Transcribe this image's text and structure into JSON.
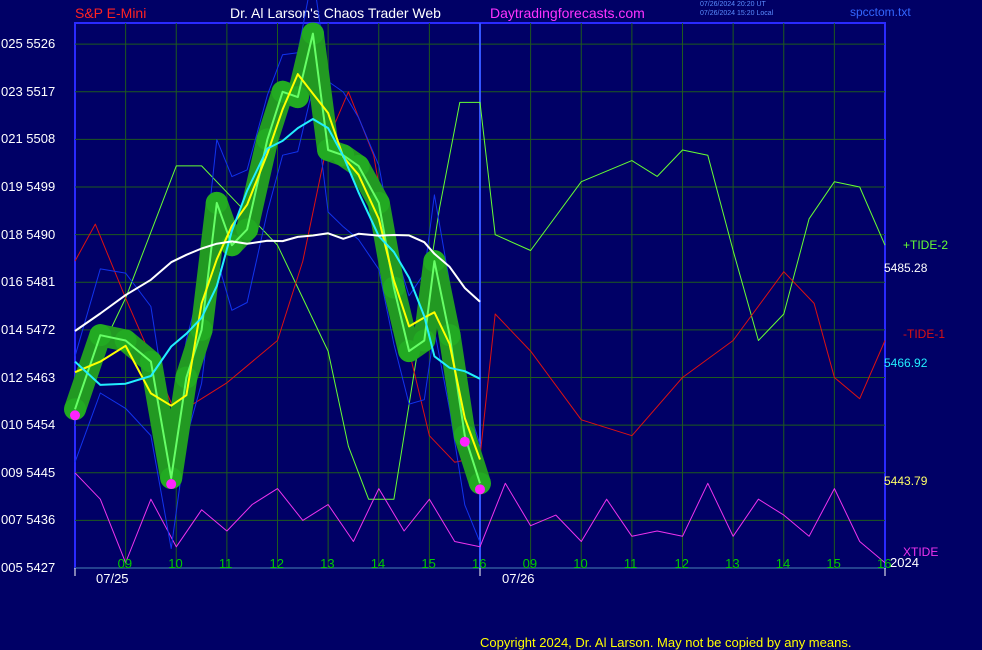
{
  "header": {
    "instrument": "S&P E-Mini",
    "site": "Dr. Al Larson's Chaos Trader Web",
    "url": "Daytradingforecasts.com",
    "time_utc": "07/26/2024 20:20 UT",
    "time_local": "07/26/2024 15:20 Local",
    "filename": "spcctom.txt"
  },
  "y_axis": {
    "left_codes": [
      "025",
      "023",
      "021",
      "019",
      "018",
      "016",
      "014",
      "012",
      "010",
      "009",
      "007",
      "005"
    ],
    "prices": [
      "5526",
      "5517",
      "5508",
      "5499",
      "5490",
      "5481",
      "5472",
      "5463",
      "5454",
      "5445",
      "5436",
      "5427"
    ],
    "range": [
      5427,
      5530
    ]
  },
  "x_axis": {
    "hour_labels_day1": [
      "09",
      "10",
      "11",
      "12",
      "13",
      "14",
      "15",
      "16"
    ],
    "hour_labels_day2": [
      "09",
      "10",
      "11",
      "12",
      "13",
      "14",
      "15",
      "16"
    ],
    "date1": "07/25",
    "date2": "07/26",
    "year": "2024"
  },
  "right_labels": {
    "tide2_label": "+TIDE-2",
    "tide1_label": "-TIDE-1",
    "xtide_label": "XTIDE",
    "value_white": "5485.28",
    "value_cyan": "5466.92",
    "value_yellow": "5443.79"
  },
  "colors": {
    "background": "#000066",
    "plot_border": "#2a2aff",
    "grid": "#1e5a1e",
    "tide2": "#66ff33",
    "tide1": "#dd1111",
    "xtide": "#ee33ee",
    "price_band": "#229922",
    "cyan_avg": "#22eeff",
    "white_avg": "#ffffff",
    "yellow_avg": "#ffff00",
    "blue_band": "#1133ee",
    "magenta_dots": "#ff22ff"
  },
  "chart_data": {
    "type": "line",
    "title": "S&P E-Mini",
    "xlabel": "",
    "ylabel": "",
    "ylim": [
      5427,
      5530
    ],
    "grid": true,
    "session_hours": [
      9,
      10,
      11,
      12,
      13,
      14,
      15,
      16
    ],
    "series": [
      {
        "name": "price",
        "x_hours_day1": [
          8.0,
          8.5,
          9.0,
          9.5,
          9.9,
          10.2,
          10.5,
          10.8,
          11.1,
          11.4,
          11.8,
          12.1,
          12.4,
          12.7,
          13.0,
          13.3,
          13.6,
          14.0,
          14.3,
          14.6,
          14.9,
          15.1,
          15.4,
          15.7,
          16.0
        ],
        "values": [
          5457,
          5471,
          5470,
          5466,
          5444,
          5463,
          5472,
          5496,
          5488,
          5491,
          5508,
          5517,
          5516,
          5528,
          5506,
          5505,
          5503,
          5496,
          5480,
          5468,
          5470,
          5485,
          5471,
          5452,
          5443
        ]
      },
      {
        "name": "+TIDE-2",
        "x_hours": [
          8.0,
          9.0,
          10.0,
          10.5,
          11.0,
          12.0,
          12.5,
          13.0,
          13.4,
          13.8,
          14.3,
          14.8,
          15.2,
          15.6,
          16.0,
          16.3,
          17.0,
          18.0,
          19.0,
          19.5,
          20.0,
          20.5,
          21.0,
          21.5,
          22.0,
          22.5,
          23.0,
          23.5,
          24.0
        ],
        "values": [
          5458,
          5478,
          5503,
          5503,
          5498,
          5488,
          5478,
          5468,
          5450,
          5440,
          5440,
          5470,
          5495,
          5515,
          5515,
          5490,
          5487,
          5500,
          5504,
          5501,
          5506,
          5505,
          5487,
          5470,
          5475,
          5493,
          5500,
          5499,
          5488
        ]
      },
      {
        "name": "-TIDE-1",
        "x_hours": [
          8.0,
          8.4,
          9.0,
          10.0,
          11.0,
          12.0,
          12.5,
          13.0,
          13.4,
          13.9,
          14.5,
          15.0,
          15.5,
          16.0,
          16.3,
          17.0,
          18.0,
          19.0,
          20.0,
          21.0,
          22.0,
          22.6,
          23.0,
          23.5,
          24.0
        ],
        "values": [
          5485,
          5492,
          5478,
          5456,
          5462,
          5470,
          5485,
          5508,
          5517,
          5505,
          5472,
          5452,
          5447,
          5448,
          5475,
          5468,
          5455,
          5452,
          5463,
          5470,
          5483,
          5477,
          5463,
          5459,
          5470
        ]
      },
      {
        "name": "XTIDE",
        "x_hours": [
          8.0,
          8.5,
          9.0,
          9.5,
          10.0,
          10.5,
          11.0,
          11.5,
          12.0,
          12.5,
          13.0,
          13.5,
          14.0,
          14.5,
          15.0,
          15.5,
          16.0,
          16.5,
          17.0,
          17.5,
          18.0,
          18.5,
          19.0,
          19.5,
          20.0,
          20.5,
          21.0,
          21.5,
          22.0,
          22.5,
          23.0,
          23.5,
          24.0
        ],
        "values": [
          5445,
          5440,
          5428,
          5440,
          5431,
          5438,
          5434,
          5439,
          5442,
          5436,
          5439,
          5432,
          5442,
          5434,
          5440,
          5432,
          5431,
          5443,
          5435,
          5437,
          5432,
          5440,
          5433,
          5434,
          5433,
          5443,
          5433,
          5440,
          5437,
          5433,
          5442,
          5432,
          5428
        ]
      }
    ]
  }
}
